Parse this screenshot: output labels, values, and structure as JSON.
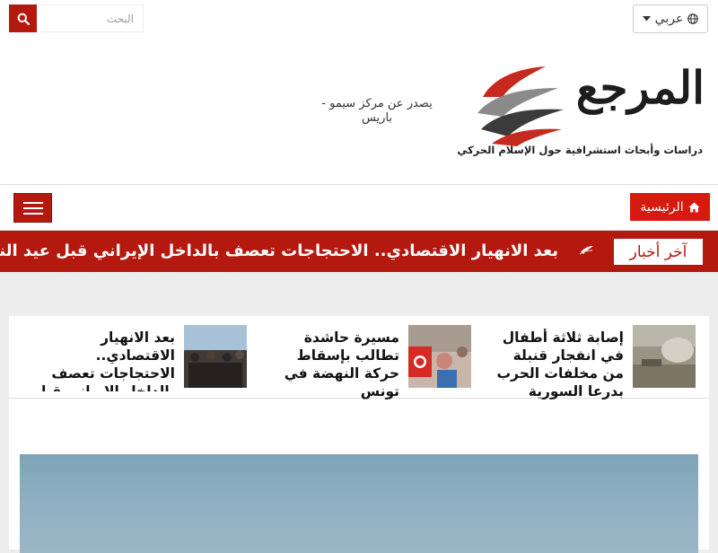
{
  "header": {
    "search": {
      "placeholder": "البحث",
      "icon": "search-icon"
    },
    "language": {
      "label": "عربي",
      "icons": [
        "globe-icon",
        "caret-down-icon"
      ]
    },
    "logo": {
      "word": "المرجع",
      "tagline": "دراسات وأبحاث استشرافية حول الإسلام الحركي",
      "colors": {
        "red": "#c0392b",
        "dark": "#3b3b3b"
      }
    },
    "publisher_note": "يصدر عن مركز سيمو - باريس"
  },
  "nav": {
    "home_label": "الرئيسية",
    "home_icon": "home-icon",
    "menu_icon": "hamburger-icon"
  },
  "ticker": {
    "label": "آخر أخبار",
    "text": "بعد الانهيار الاقتصادي.. الاحتجاجات تعصف بالداخل الإيراني قبل عيد النيروز"
  },
  "news": [
    {
      "title": "إصابة ثلاثة أطفال في انفجار قنبلة من مخلفات الحرب بدرعا السورية"
    },
    {
      "title": "مسيرة حاشدة تطالب بإسقاط حركة النهضة في تونس"
    },
    {
      "title": "بعد الانهيار الاقتصادي.. الاحتجاجات تعصف بالداخل الإيراني قبل عيد النيروز"
    }
  ],
  "colors": {
    "brand_red": "#b3190f",
    "button_red": "#d71a0f",
    "page_bg": "#ededed"
  }
}
